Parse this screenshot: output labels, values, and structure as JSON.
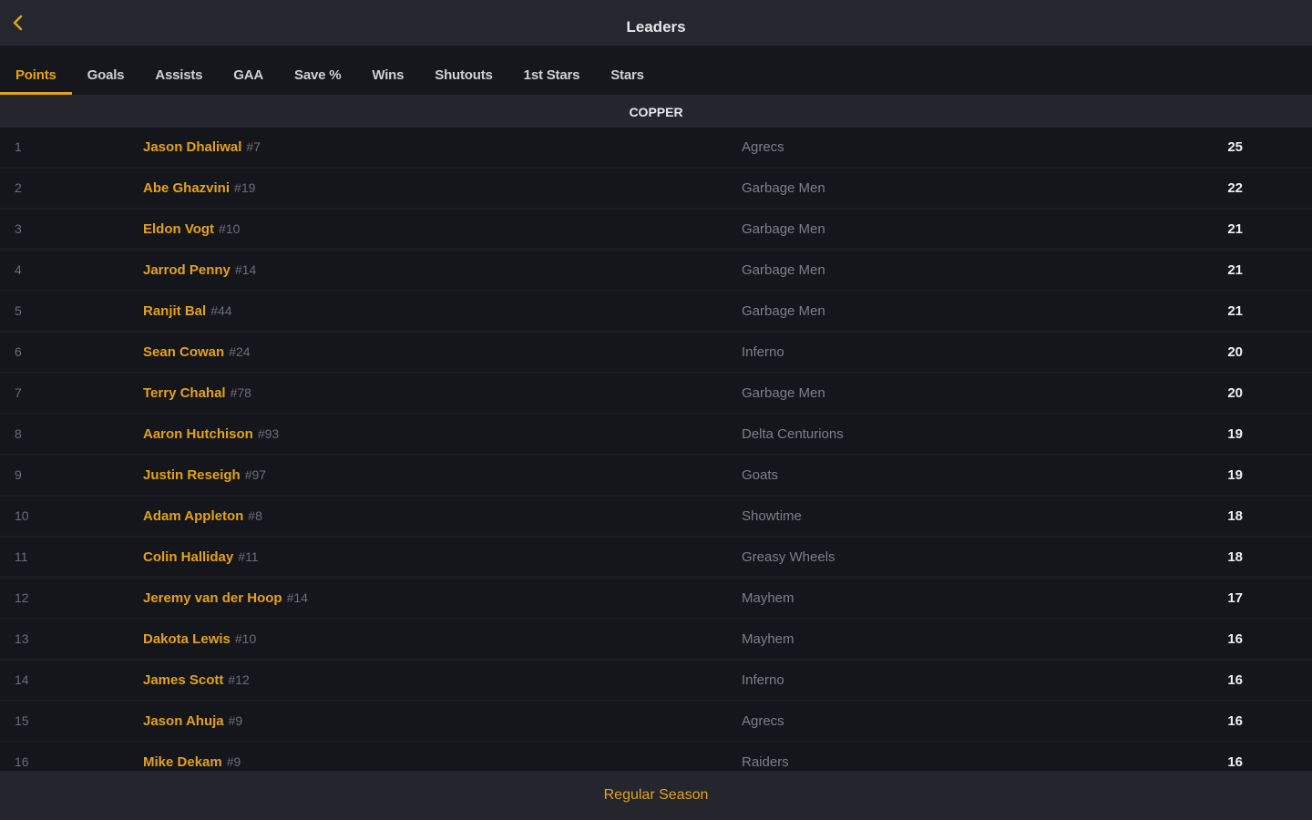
{
  "header": {
    "title": "Leaders"
  },
  "colors": {
    "accent": "#e3a21a",
    "background": "#14151a",
    "header": "#25262e"
  },
  "tabs": [
    {
      "label": "Points",
      "active": true
    },
    {
      "label": "Goals"
    },
    {
      "label": "Assists"
    },
    {
      "label": "GAA"
    },
    {
      "label": "Save %"
    },
    {
      "label": "Wins"
    },
    {
      "label": "Shutouts"
    },
    {
      "label": "1st Stars"
    },
    {
      "label": "Stars"
    }
  ],
  "section": {
    "title": "COPPER"
  },
  "rows": [
    {
      "rank": "1",
      "name": "Jason Dhaliwal",
      "number": "#7",
      "team": "Agrecs",
      "value": "25"
    },
    {
      "rank": "2",
      "name": "Abe Ghazvini",
      "number": "#19",
      "team": "Garbage Men",
      "value": "22"
    },
    {
      "rank": "3",
      "name": "Eldon Vogt",
      "number": "#10",
      "team": "Garbage Men",
      "value": "21"
    },
    {
      "rank": "4",
      "name": "Jarrod Penny",
      "number": "#14",
      "team": "Garbage Men",
      "value": "21"
    },
    {
      "rank": "5",
      "name": "Ranjit Bal",
      "number": "#44",
      "team": "Garbage Men",
      "value": "21"
    },
    {
      "rank": "6",
      "name": "Sean Cowan",
      "number": "#24",
      "team": "Inferno",
      "value": "20"
    },
    {
      "rank": "7",
      "name": "Terry Chahal",
      "number": "#78",
      "team": "Garbage Men",
      "value": "20"
    },
    {
      "rank": "8",
      "name": "Aaron Hutchison",
      "number": "#93",
      "team": "Delta Centurions",
      "value": "19"
    },
    {
      "rank": "9",
      "name": "Justin Reseigh",
      "number": "#97",
      "team": "Goats",
      "value": "19"
    },
    {
      "rank": "10",
      "name": "Adam Appleton",
      "number": "#8",
      "team": "Showtime",
      "value": "18"
    },
    {
      "rank": "11",
      "name": "Colin Halliday",
      "number": "#11",
      "team": "Greasy Wheels",
      "value": "18"
    },
    {
      "rank": "12",
      "name": "Jeremy van der Hoop",
      "number": "#14",
      "team": "Mayhem",
      "value": "17"
    },
    {
      "rank": "13",
      "name": "Dakota Lewis",
      "number": "#10",
      "team": "Mayhem",
      "value": "16"
    },
    {
      "rank": "14",
      "name": "James Scott",
      "number": "#12",
      "team": "Inferno",
      "value": "16"
    },
    {
      "rank": "15",
      "name": "Jason Ahuja",
      "number": "#9",
      "team": "Agrecs",
      "value": "16"
    },
    {
      "rank": "16",
      "name": "Mike Dekam",
      "number": "#9",
      "team": "Raiders",
      "value": "16"
    }
  ],
  "footer": {
    "label": "Regular Season"
  }
}
